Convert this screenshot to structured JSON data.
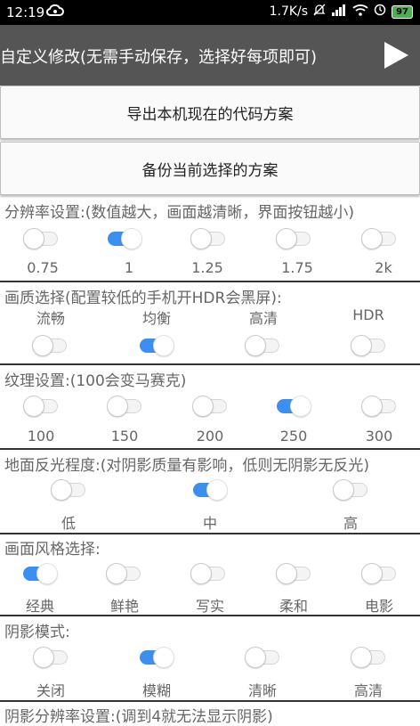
{
  "status": {
    "time": "12:19",
    "speed": "1.7K/s",
    "battery": "97"
  },
  "titlebar": {
    "title": "自定义修改(无需手动保存，选择好每项即可)"
  },
  "buttons": {
    "export": "导出本机现在的代码方案",
    "backup": "备份当前选择的方案"
  },
  "sections": [
    {
      "title": "分辨率设置:(数值越大，画面越清晰，界面按钮越小)",
      "options": [
        {
          "label": "0.75",
          "on": false
        },
        {
          "label": "1",
          "on": true
        },
        {
          "label": "1.25",
          "on": false
        },
        {
          "label": "1.75",
          "on": false
        },
        {
          "label": "2k",
          "on": false
        }
      ]
    },
    {
      "title": "画质选择(配置较低的手机开HDR会黑屏):",
      "options": [
        {
          "label": "流畅",
          "on": false
        },
        {
          "label": "均衡",
          "on": true
        },
        {
          "label": "高清",
          "on": false
        },
        {
          "label": "HDR",
          "on": false
        }
      ]
    },
    {
      "title": "纹理设置:(100会变马赛克)",
      "options": [
        {
          "label": "100",
          "on": false
        },
        {
          "label": "150",
          "on": false
        },
        {
          "label": "200",
          "on": false
        },
        {
          "label": "250",
          "on": true
        },
        {
          "label": "300",
          "on": false
        }
      ]
    },
    {
      "title": "地面反光程度:(对阴影质量有影响，低则无阴影无反光)",
      "options": [
        {
          "label": "低",
          "on": false
        },
        {
          "label": "中",
          "on": true
        },
        {
          "label": "高",
          "on": false
        }
      ]
    },
    {
      "title": "画面风格选择:",
      "options": [
        {
          "label": "经典",
          "on": true
        },
        {
          "label": "鲜艳",
          "on": false
        },
        {
          "label": "写实",
          "on": false
        },
        {
          "label": "柔和",
          "on": false
        },
        {
          "label": "电影",
          "on": false
        }
      ]
    },
    {
      "title": "阴影模式:",
      "options": [
        {
          "label": "关闭",
          "on": false
        },
        {
          "label": "模糊",
          "on": true
        },
        {
          "label": "清晰",
          "on": false
        },
        {
          "label": "高清",
          "on": false
        }
      ]
    },
    {
      "title": "阴影分辨率设置:(调到4就无法显示阴影)",
      "options": []
    }
  ],
  "colors": {
    "accent": "#3a8ff0",
    "titlebar": "#555555"
  }
}
